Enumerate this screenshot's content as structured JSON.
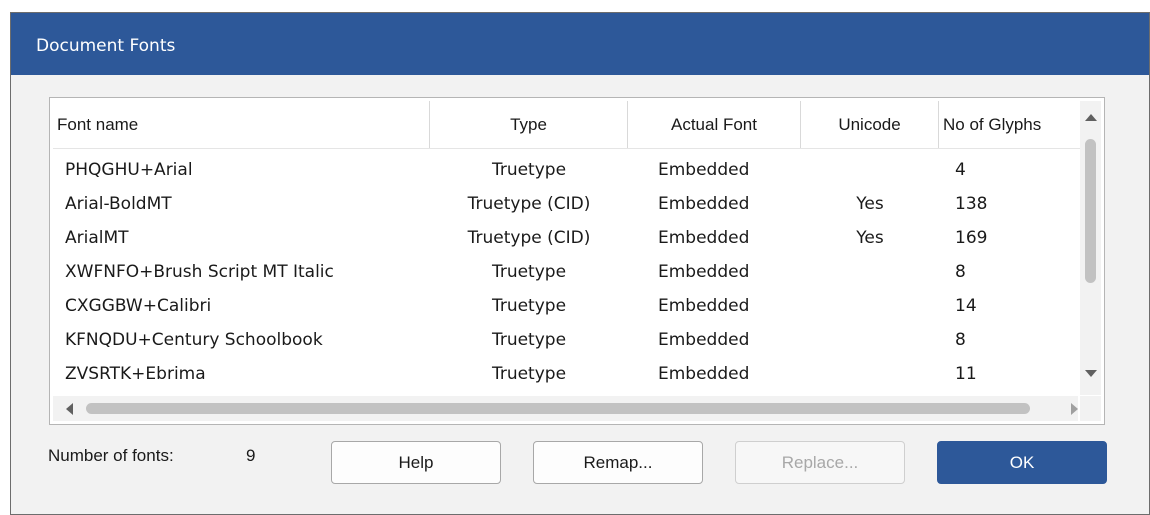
{
  "window": {
    "title": "Document Fonts"
  },
  "table": {
    "columns": [
      "Font name",
      "Type",
      "Actual Font",
      "Unicode",
      "No of Glyphs"
    ],
    "rows": [
      {
        "name": "PHQGHU+Arial",
        "type": "Truetype",
        "actual": "Embedded",
        "unicode": "",
        "glyphs": "4"
      },
      {
        "name": "Arial-BoldMT",
        "type": "Truetype (CID)",
        "actual": "Embedded",
        "unicode": "Yes",
        "glyphs": "138"
      },
      {
        "name": "ArialMT",
        "type": "Truetype (CID)",
        "actual": "Embedded",
        "unicode": "Yes",
        "glyphs": "169"
      },
      {
        "name": "XWFNFO+Brush Script MT Italic",
        "type": "Truetype",
        "actual": "Embedded",
        "unicode": "",
        "glyphs": "8"
      },
      {
        "name": "CXGGBW+Calibri",
        "type": "Truetype",
        "actual": "Embedded",
        "unicode": "",
        "glyphs": "14"
      },
      {
        "name": "KFNQDU+Century Schoolbook",
        "type": "Truetype",
        "actual": "Embedded",
        "unicode": "",
        "glyphs": "8"
      },
      {
        "name": "ZVSRTK+Ebrima",
        "type": "Truetype",
        "actual": "Embedded",
        "unicode": "",
        "glyphs": "11"
      }
    ]
  },
  "footer": {
    "count_label": "Number of fonts:",
    "count_value": "9",
    "buttons": {
      "help": "Help",
      "remap": "Remap...",
      "replace": "Replace...",
      "ok": "OK"
    }
  },
  "colors": {
    "accent": "#2d5899",
    "dialog_bg": "#f2f2f2",
    "disabled_text": "#a8a8a8"
  },
  "icons": {
    "scroll_up": "arrow-up-icon",
    "scroll_down": "arrow-down-icon",
    "scroll_left": "arrow-left-icon",
    "scroll_right": "arrow-right-icon"
  }
}
